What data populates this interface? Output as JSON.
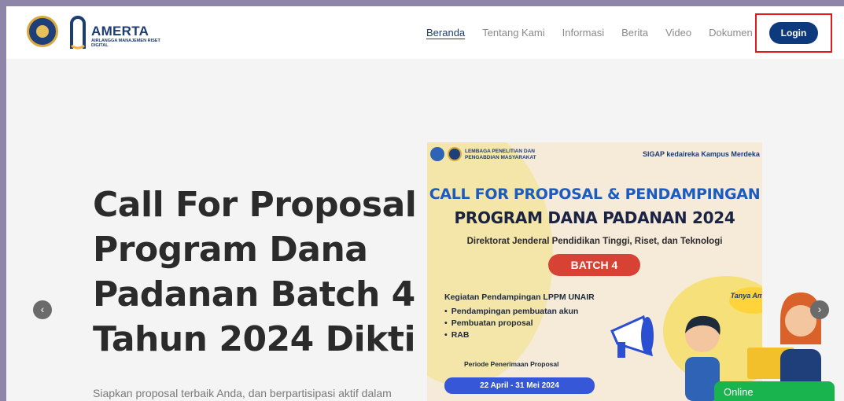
{
  "header": {
    "brand_name": "AMERTA",
    "brand_sub": "AIRLANGGA MANAJEMEN RISET DIGITAL",
    "nav": [
      {
        "label": "Beranda",
        "active": true
      },
      {
        "label": "Tentang Kami",
        "active": false
      },
      {
        "label": "Informasi",
        "active": false
      },
      {
        "label": "Berita",
        "active": false
      },
      {
        "label": "Video",
        "active": false
      },
      {
        "label": "Dokumen",
        "active": false
      }
    ],
    "login_label": "Login"
  },
  "hero": {
    "title": "Call For Proposal Program Dana Padanan Batch 4 Tahun 2024 Dikti",
    "subtitle": "Siapkan proposal terbaik Anda, dan berpartisipasi aktif dalam"
  },
  "carousel": {
    "prev_icon": "‹",
    "next_icon": "›"
  },
  "poster": {
    "institution": "LEMBAGA PENELITIAN DAN PENGABDIAN MASYARAKAT",
    "partners": "SIGAP   kedaireka   Kampus Merdeka",
    "call": "CALL FOR PROPOSAL & PENDAMPINGAN",
    "program": "PROGRAM DANA PADANAN 2024",
    "dirjen": "Direktorat Jenderal Pendidikan Tinggi, Riset, dan Teknologi",
    "batch": "BATCH 4",
    "kegiatan": "Kegiatan Pendampingan LPPM UNAIR",
    "items": [
      "Pendampingan pembuatan akun",
      "Pembuatan proposal",
      "RAB"
    ],
    "periode": "Periode Penerimaan Proposal",
    "dates": "22 April - 31 Mei 2024",
    "bubble": "Tanya Amerta"
  },
  "chat": {
    "status": "Online"
  },
  "colors": {
    "brand": "#0d3a7d",
    "accent_red": "#e01b1b",
    "online_green": "#19b44d"
  }
}
